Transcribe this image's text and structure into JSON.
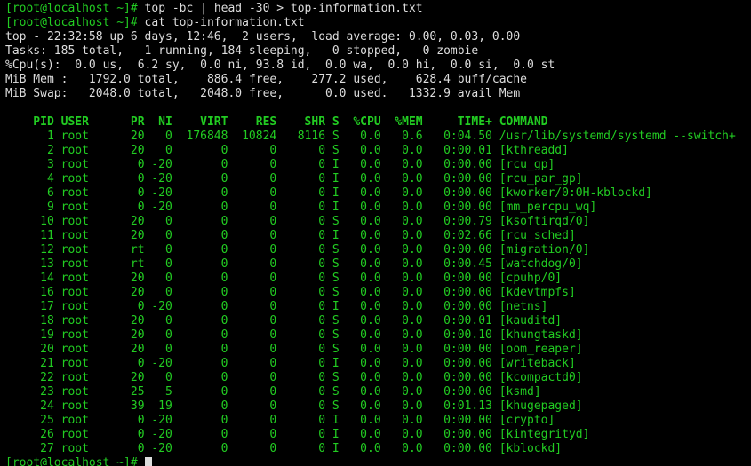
{
  "prompt": {
    "user_host": "[root@localhost ~]#",
    "cmd1": "top -bc | head -30 > top-information.txt",
    "cmd2": "cat top-information.txt"
  },
  "summary_lines": [
    "top - 22:32:58 up 6 days, 12:46,  2 users,  load average: 0.00, 0.03, 0.00",
    "Tasks: 185 total,   1 running, 184 sleeping,   0 stopped,   0 zombie",
    "%Cpu(s):  0.0 us,  6.2 sy,  0.0 ni, 93.8 id,  0.0 wa,  0.0 hi,  0.0 si,  0.0 st",
    "MiB Mem :   1792.0 total,    886.4 free,    277.2 used,    628.4 buff/cache",
    "MiB Swap:   2048.0 total,   2048.0 free,      0.0 used.   1332.9 avail Mem"
  ],
  "header": "    PID USER      PR  NI    VIRT    RES    SHR S  %CPU  %MEM     TIME+ COMMAND",
  "processes": [
    {
      "pid": 1,
      "user": "root",
      "pr": "20",
      "ni": "0",
      "virt": "176848",
      "res": "10824",
      "shr": "8116",
      "s": "S",
      "cpu": "0.0",
      "mem": "0.6",
      "time": "0:04.50",
      "cmd": "/usr/lib/systemd/systemd --switch+"
    },
    {
      "pid": 2,
      "user": "root",
      "pr": "20",
      "ni": "0",
      "virt": "0",
      "res": "0",
      "shr": "0",
      "s": "S",
      "cpu": "0.0",
      "mem": "0.0",
      "time": "0:00.01",
      "cmd": "[kthreadd]"
    },
    {
      "pid": 3,
      "user": "root",
      "pr": "0",
      "ni": "-20",
      "virt": "0",
      "res": "0",
      "shr": "0",
      "s": "I",
      "cpu": "0.0",
      "mem": "0.0",
      "time": "0:00.00",
      "cmd": "[rcu_gp]"
    },
    {
      "pid": 4,
      "user": "root",
      "pr": "0",
      "ni": "-20",
      "virt": "0",
      "res": "0",
      "shr": "0",
      "s": "I",
      "cpu": "0.0",
      "mem": "0.0",
      "time": "0:00.00",
      "cmd": "[rcu_par_gp]"
    },
    {
      "pid": 6,
      "user": "root",
      "pr": "0",
      "ni": "-20",
      "virt": "0",
      "res": "0",
      "shr": "0",
      "s": "I",
      "cpu": "0.0",
      "mem": "0.0",
      "time": "0:00.00",
      "cmd": "[kworker/0:0H-kblockd]"
    },
    {
      "pid": 9,
      "user": "root",
      "pr": "0",
      "ni": "-20",
      "virt": "0",
      "res": "0",
      "shr": "0",
      "s": "I",
      "cpu": "0.0",
      "mem": "0.0",
      "time": "0:00.00",
      "cmd": "[mm_percpu_wq]"
    },
    {
      "pid": 10,
      "user": "root",
      "pr": "20",
      "ni": "0",
      "virt": "0",
      "res": "0",
      "shr": "0",
      "s": "S",
      "cpu": "0.0",
      "mem": "0.0",
      "time": "0:00.79",
      "cmd": "[ksoftirqd/0]"
    },
    {
      "pid": 11,
      "user": "root",
      "pr": "20",
      "ni": "0",
      "virt": "0",
      "res": "0",
      "shr": "0",
      "s": "I",
      "cpu": "0.0",
      "mem": "0.0",
      "time": "0:02.66",
      "cmd": "[rcu_sched]"
    },
    {
      "pid": 12,
      "user": "root",
      "pr": "rt",
      "ni": "0",
      "virt": "0",
      "res": "0",
      "shr": "0",
      "s": "S",
      "cpu": "0.0",
      "mem": "0.0",
      "time": "0:00.00",
      "cmd": "[migration/0]"
    },
    {
      "pid": 13,
      "user": "root",
      "pr": "rt",
      "ni": "0",
      "virt": "0",
      "res": "0",
      "shr": "0",
      "s": "S",
      "cpu": "0.0",
      "mem": "0.0",
      "time": "0:00.45",
      "cmd": "[watchdog/0]"
    },
    {
      "pid": 14,
      "user": "root",
      "pr": "20",
      "ni": "0",
      "virt": "0",
      "res": "0",
      "shr": "0",
      "s": "S",
      "cpu": "0.0",
      "mem": "0.0",
      "time": "0:00.00",
      "cmd": "[cpuhp/0]"
    },
    {
      "pid": 16,
      "user": "root",
      "pr": "20",
      "ni": "0",
      "virt": "0",
      "res": "0",
      "shr": "0",
      "s": "S",
      "cpu": "0.0",
      "mem": "0.0",
      "time": "0:00.00",
      "cmd": "[kdevtmpfs]"
    },
    {
      "pid": 17,
      "user": "root",
      "pr": "0",
      "ni": "-20",
      "virt": "0",
      "res": "0",
      "shr": "0",
      "s": "I",
      "cpu": "0.0",
      "mem": "0.0",
      "time": "0:00.00",
      "cmd": "[netns]"
    },
    {
      "pid": 18,
      "user": "root",
      "pr": "20",
      "ni": "0",
      "virt": "0",
      "res": "0",
      "shr": "0",
      "s": "S",
      "cpu": "0.0",
      "mem": "0.0",
      "time": "0:00.01",
      "cmd": "[kauditd]"
    },
    {
      "pid": 19,
      "user": "root",
      "pr": "20",
      "ni": "0",
      "virt": "0",
      "res": "0",
      "shr": "0",
      "s": "S",
      "cpu": "0.0",
      "mem": "0.0",
      "time": "0:00.10",
      "cmd": "[khungtaskd]"
    },
    {
      "pid": 20,
      "user": "root",
      "pr": "20",
      "ni": "0",
      "virt": "0",
      "res": "0",
      "shr": "0",
      "s": "S",
      "cpu": "0.0",
      "mem": "0.0",
      "time": "0:00.00",
      "cmd": "[oom_reaper]"
    },
    {
      "pid": 21,
      "user": "root",
      "pr": "0",
      "ni": "-20",
      "virt": "0",
      "res": "0",
      "shr": "0",
      "s": "I",
      "cpu": "0.0",
      "mem": "0.0",
      "time": "0:00.00",
      "cmd": "[writeback]"
    },
    {
      "pid": 22,
      "user": "root",
      "pr": "20",
      "ni": "0",
      "virt": "0",
      "res": "0",
      "shr": "0",
      "s": "S",
      "cpu": "0.0",
      "mem": "0.0",
      "time": "0:00.00",
      "cmd": "[kcompactd0]"
    },
    {
      "pid": 23,
      "user": "root",
      "pr": "25",
      "ni": "5",
      "virt": "0",
      "res": "0",
      "shr": "0",
      "s": "S",
      "cpu": "0.0",
      "mem": "0.0",
      "time": "0:00.00",
      "cmd": "[ksmd]"
    },
    {
      "pid": 24,
      "user": "root",
      "pr": "39",
      "ni": "19",
      "virt": "0",
      "res": "0",
      "shr": "0",
      "s": "S",
      "cpu": "0.0",
      "mem": "0.0",
      "time": "0:01.13",
      "cmd": "[khugepaged]"
    },
    {
      "pid": 25,
      "user": "root",
      "pr": "0",
      "ni": "-20",
      "virt": "0",
      "res": "0",
      "shr": "0",
      "s": "I",
      "cpu": "0.0",
      "mem": "0.0",
      "time": "0:00.00",
      "cmd": "[crypto]"
    },
    {
      "pid": 26,
      "user": "root",
      "pr": "0",
      "ni": "-20",
      "virt": "0",
      "res": "0",
      "shr": "0",
      "s": "I",
      "cpu": "0.0",
      "mem": "0.0",
      "time": "0:00.00",
      "cmd": "[kintegrityd]"
    },
    {
      "pid": 27,
      "user": "root",
      "pr": "0",
      "ni": "-20",
      "virt": "0",
      "res": "0",
      "shr": "0",
      "s": "I",
      "cpu": "0.0",
      "mem": "0.0",
      "time": "0:00.00",
      "cmd": "[kblockd]"
    }
  ]
}
